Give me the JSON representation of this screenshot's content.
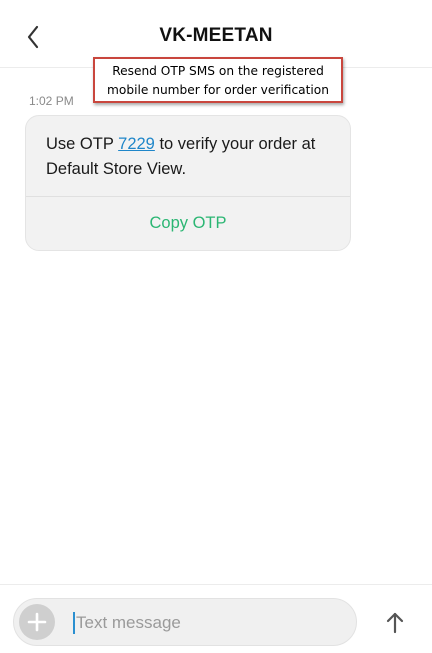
{
  "header": {
    "title": "VK-MEETAN",
    "back_icon": "back-arrow-icon"
  },
  "callout": {
    "text_line1": "Resend OTP SMS on the registered",
    "text_line2": "mobile number for order verification",
    "border_color": "#c9463d"
  },
  "conversation": {
    "timestamp": "1:02 PM",
    "message": {
      "text_prefix": "Use OTP ",
      "otp": "7229",
      "text_suffix": " to verify your order at Default Store View.",
      "action_label": "Copy OTP",
      "action_color": "#2bb673",
      "link_color": "#1f86c9"
    }
  },
  "composer": {
    "placeholder": "Text message",
    "add_icon": "plus-icon",
    "send_icon": "arrow-up-icon"
  }
}
